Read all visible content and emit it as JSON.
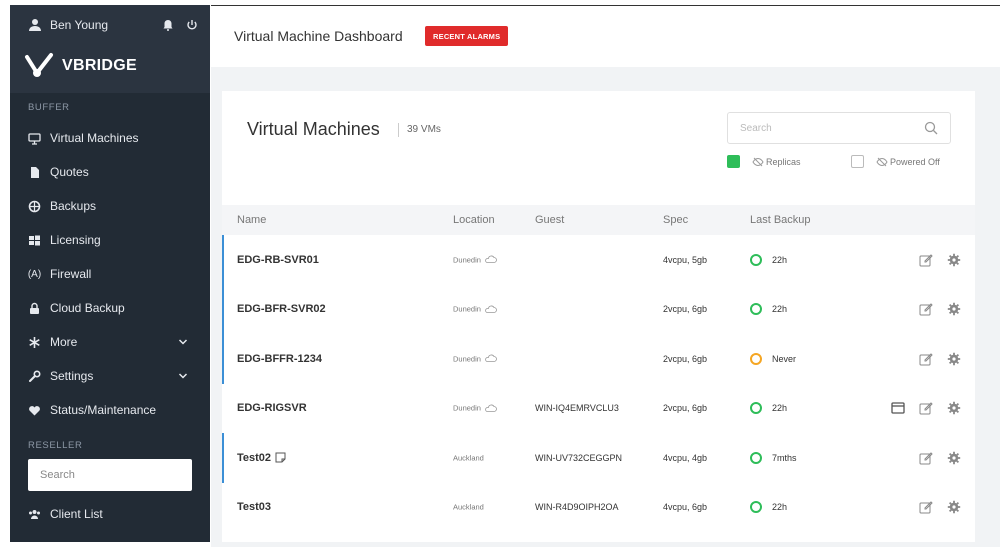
{
  "user": {
    "name": "Ben Young"
  },
  "brand": {
    "name": "VBRIDGE"
  },
  "sidebar": {
    "buffer_label": "BUFFER",
    "items": [
      {
        "label": "Virtual Machines",
        "icon": "monitor-icon"
      },
      {
        "label": "Quotes",
        "icon": "document-icon"
      },
      {
        "label": "Backups",
        "icon": "backup-icon"
      },
      {
        "label": "Licensing",
        "icon": "windows-icon"
      },
      {
        "label": "Firewall",
        "icon": "firewall-icon",
        "glyph": "(A)"
      },
      {
        "label": "Cloud Backup",
        "icon": "lock-icon"
      },
      {
        "label": "More",
        "icon": "asterisk-icon"
      },
      {
        "label": "Settings",
        "icon": "wrench-icon"
      },
      {
        "label": "Status/Maintenance",
        "icon": "heart-icon"
      }
    ],
    "reseller_label": "RESELLER",
    "search_placeholder": "Search",
    "client_list_label": "Client List"
  },
  "header": {
    "title": "Virtual Machine Dashboard",
    "alarm_button": "RECENT ALARMS"
  },
  "card": {
    "title": "Virtual Machines",
    "count": "39 VMs",
    "search_placeholder": "Search",
    "filters": [
      {
        "label": "Replicas",
        "checked": true
      },
      {
        "label": "Powered Off",
        "checked": false
      }
    ]
  },
  "table": {
    "columns": [
      "Name",
      "Location",
      "Guest",
      "Spec",
      "Last Backup"
    ],
    "rows": [
      {
        "name": "EDG-RB-SVR01",
        "location": "Dunedin",
        "guest": "",
        "spec": "4vcpu, 5gb",
        "last_backup": "22h",
        "status": "ok"
      },
      {
        "name": "EDG-BFR-SVR02",
        "location": "Dunedin",
        "guest": "",
        "spec": "2vcpu, 6gb",
        "last_backup": "22h",
        "status": "ok"
      },
      {
        "name": "EDG-BFFR-1234",
        "location": "Dunedin",
        "guest": "",
        "spec": "2vcpu, 6gb",
        "last_backup": "Never",
        "status": "warning"
      },
      {
        "name": "EDG-RIGSVR",
        "location": "Dunedin",
        "guest": "WIN-IQ4EMRVCLU3",
        "spec": "2vcpu, 6gb",
        "last_backup": "22h",
        "status": "ok"
      },
      {
        "name": "Test02",
        "location": "Auckland",
        "guest": "WIN-UV732CEGGPN",
        "spec": "4vcpu, 4gb",
        "last_backup": "7mths",
        "status": "ok"
      },
      {
        "name": "Test03",
        "location": "Auckland",
        "guest": "WIN-R4D9OIPH2OA",
        "spec": "4vcpu, 6gb",
        "last_backup": "22h",
        "status": "ok"
      }
    ]
  },
  "colors": {
    "sidebar": "#2b3440",
    "alarm": "#e02b2b",
    "ok": "#2ebd59",
    "warning": "#f5a623",
    "accent": "#3b8fd6"
  }
}
